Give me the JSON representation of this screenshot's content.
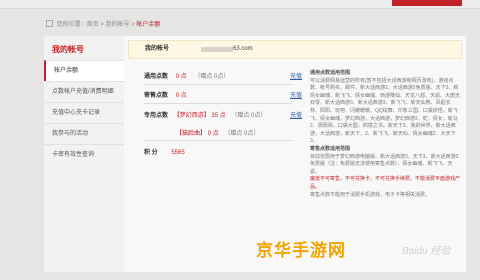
{
  "breadcrumb": [
    "您的位置：首页",
    "我的帐号",
    "帐户余额"
  ],
  "sidebar": {
    "title": "我的帐号",
    "items": [
      "帐户余额",
      "点数帐户充值/消费明细",
      "充值中心充卡记录",
      "我参与的活动",
      "卡密有效性查询"
    ]
  },
  "account": {
    "label": "我的帐号",
    "email_suffix": "63.com"
  },
  "balances": {
    "general": {
      "label": "通用点数",
      "value": "0 点",
      "gift": "（赠点 0点）",
      "action": "充值"
    },
    "consign": {
      "label": "寄售点数",
      "value": "0 点",
      "action": "充值"
    },
    "special": {
      "label": "专用点数",
      "game1": "【梦幻西游】",
      "value1": "35 点",
      "gift1": "（赠点 0点）",
      "action": "充值",
      "game2": "【猫脸曲】",
      "value2": "0 点",
      "gift2": "（赠点 0点）"
    },
    "points": {
      "label": "积   分",
      "value": "5565"
    }
  },
  "notes": {
    "general_title": "通用点数适用范围",
    "general_text": "可以消费网易运营的所有(暂不包括大话西游和网页游戏)，游戏点数、帐号购买、邮件、新大话西游2、大话西游2免费版、天下3、新倩女幽魂、新飞飞、倩女幽魂、西游降仙、天龙八部、天谕、大唐无双零、新大话西游3、新大话西游3、新飞飞、斩天仙祭、风起长林、阳阳、玩吧、闪耀暖暖、QQ炫舞、印象三国、口袋妖怪，新飞飞、倩女幽魂，梦幻西游，大话西游，梦幻西游2、蛇，倩女，斩马2、阴阳师，口袋大图，四境之书，新天下3、我的世界、新大话西游，大话西游，新天下、2、新飞飞，斩天仙、倩女幽魂2、大天下 3。",
    "consign_title": "寄售点数适用范围",
    "consign_text": "目前仅限用于梦幻西游电脑版、新大话西游3、天下3、新大话西游3免费版（注：免费版无法使用寄售点数）、倩女幽魂、新飞飞、天谕、",
    "highlight": "魔兽不可寄售，不可兑换卡，不可兑换手续费，不能消费平面游戏产品。",
    "extra": "寄售点数不能用于消费手机游戏、电子卡等相关消费。"
  },
  "watermark": "京华手游网",
  "photo_credit": "Baidu 经验"
}
